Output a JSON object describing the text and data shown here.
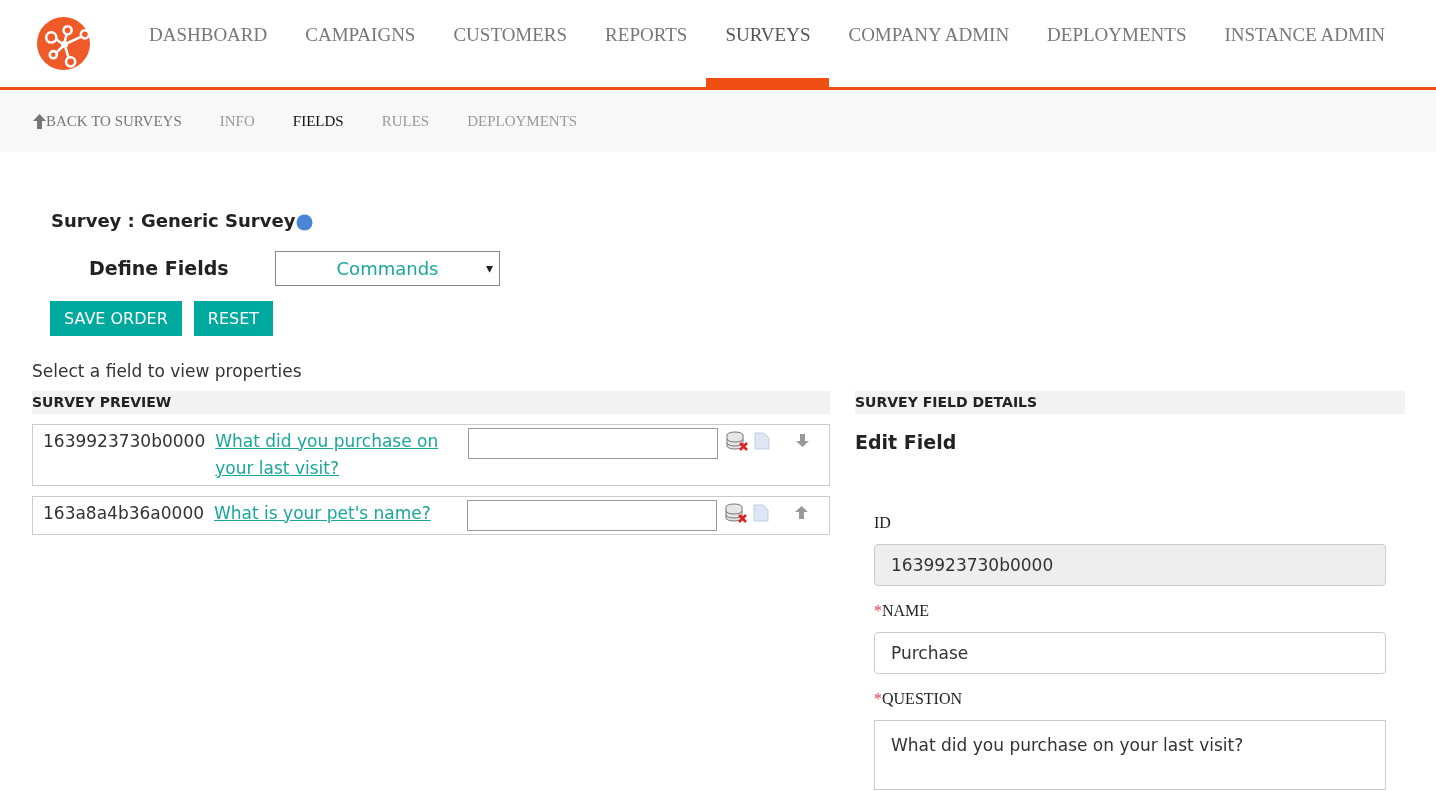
{
  "nav": {
    "items": [
      {
        "label": "DASHBOARD",
        "selected": false
      },
      {
        "label": "CAMPAIGNS",
        "selected": false
      },
      {
        "label": "CUSTOMERS",
        "selected": false
      },
      {
        "label": "REPORTS",
        "selected": false
      },
      {
        "label": "SURVEYS",
        "selected": true
      },
      {
        "label": "COMPANY ADMIN",
        "selected": false
      },
      {
        "label": "DEPLOYMENTS",
        "selected": false
      },
      {
        "label": "INSTANCE ADMIN",
        "selected": false
      }
    ]
  },
  "subnav": {
    "back": "BACK TO SURVEYS",
    "items": [
      {
        "label": "INFO",
        "selected": false
      },
      {
        "label": "FIELDS",
        "selected": true
      },
      {
        "label": "RULES",
        "selected": false
      },
      {
        "label": "DEPLOYMENTS",
        "selected": false
      }
    ]
  },
  "survey_title": "Survey : Generic Survey",
  "define_label": "Define Fields",
  "commands": {
    "value": "Commands",
    "caret": "▾"
  },
  "buttons": [
    "SAVE ORDER",
    "RESET"
  ],
  "hint": "Select a field to view properties",
  "preview": {
    "heading": "SURVEY PREVIEW",
    "rows": [
      {
        "id": "1639923730b0000",
        "question": "What did you purchase on your last visit?",
        "kind": "down"
      },
      {
        "id": "163a8a4b36a0000",
        "question": "What is your pet's name?",
        "kind": "up"
      }
    ]
  },
  "details": {
    "heading": "SURVEY FIELD DETAILS",
    "title": "Edit Field",
    "fields": [
      {
        "label": "ID",
        "value": "1639923730b0000",
        "disabled": true,
        "kind": "input"
      },
      {
        "label": "NAME",
        "required_mark": "*",
        "value": "Purchase",
        "disabled": false,
        "kind": "input"
      },
      {
        "label": "QUESTION",
        "required_mark": "*",
        "value": "What did you purchase on your last visit?",
        "disabled": false,
        "kind": "textarea"
      }
    ]
  }
}
